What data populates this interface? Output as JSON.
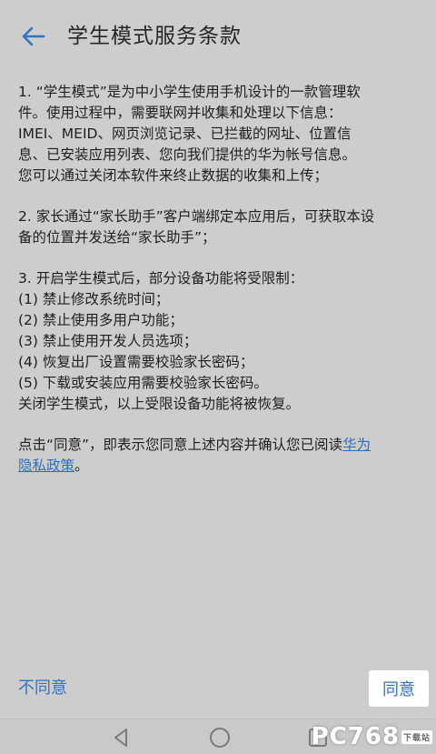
{
  "header": {
    "title": "学生模式服务条款"
  },
  "content": {
    "para1": {
      "line1": "1. “学生模式”是为中小学生使用手机设计的一款管理软",
      "line2": "件。使用过程中，需要联网并收集和处理以下信息：",
      "line3": "IMEI、MEID、网页浏览记录、已拦截的网址、位置信",
      "line4": "息、已安装应用列表、您向我们提供的华为帐号信息。",
      "line5": "您可以通过关闭本软件来终止数据的收集和上传；"
    },
    "para2": {
      "line1": "2. 家长通过“家长助手”客户端绑定本应用后，可获取本设",
      "line2": "备的位置并发送给“家长助手”；"
    },
    "para3": {
      "line1": "3. 开启学生模式后，部分设备功能将受限制：",
      "item1": " (1) 禁止修改系统时间；",
      "item2": " (2) 禁止使用多用户功能；",
      "item3": " (3) 禁止使用开发人员选项；",
      "item4": " (4) 恢复出厂设置需要校验家长密码；",
      "item5": " (5) 下载或安装应用需要校验家长密码。",
      "line7": "关闭学生模式，以上受限设备功能将被恢复。"
    },
    "para4": {
      "text_before": "点击“同意”，即表示您同意上述内容并确认您已阅读",
      "link_part1": "华为",
      "link_part2": "隐私政策",
      "text_after": "。"
    }
  },
  "footer": {
    "disagree_label": "不同意",
    "agree_label": "同意"
  },
  "watermark": {
    "brand": "PC768",
    "sub": "下载站"
  },
  "colors": {
    "accent": "#2f72c6",
    "background": "#cdcdcd"
  }
}
